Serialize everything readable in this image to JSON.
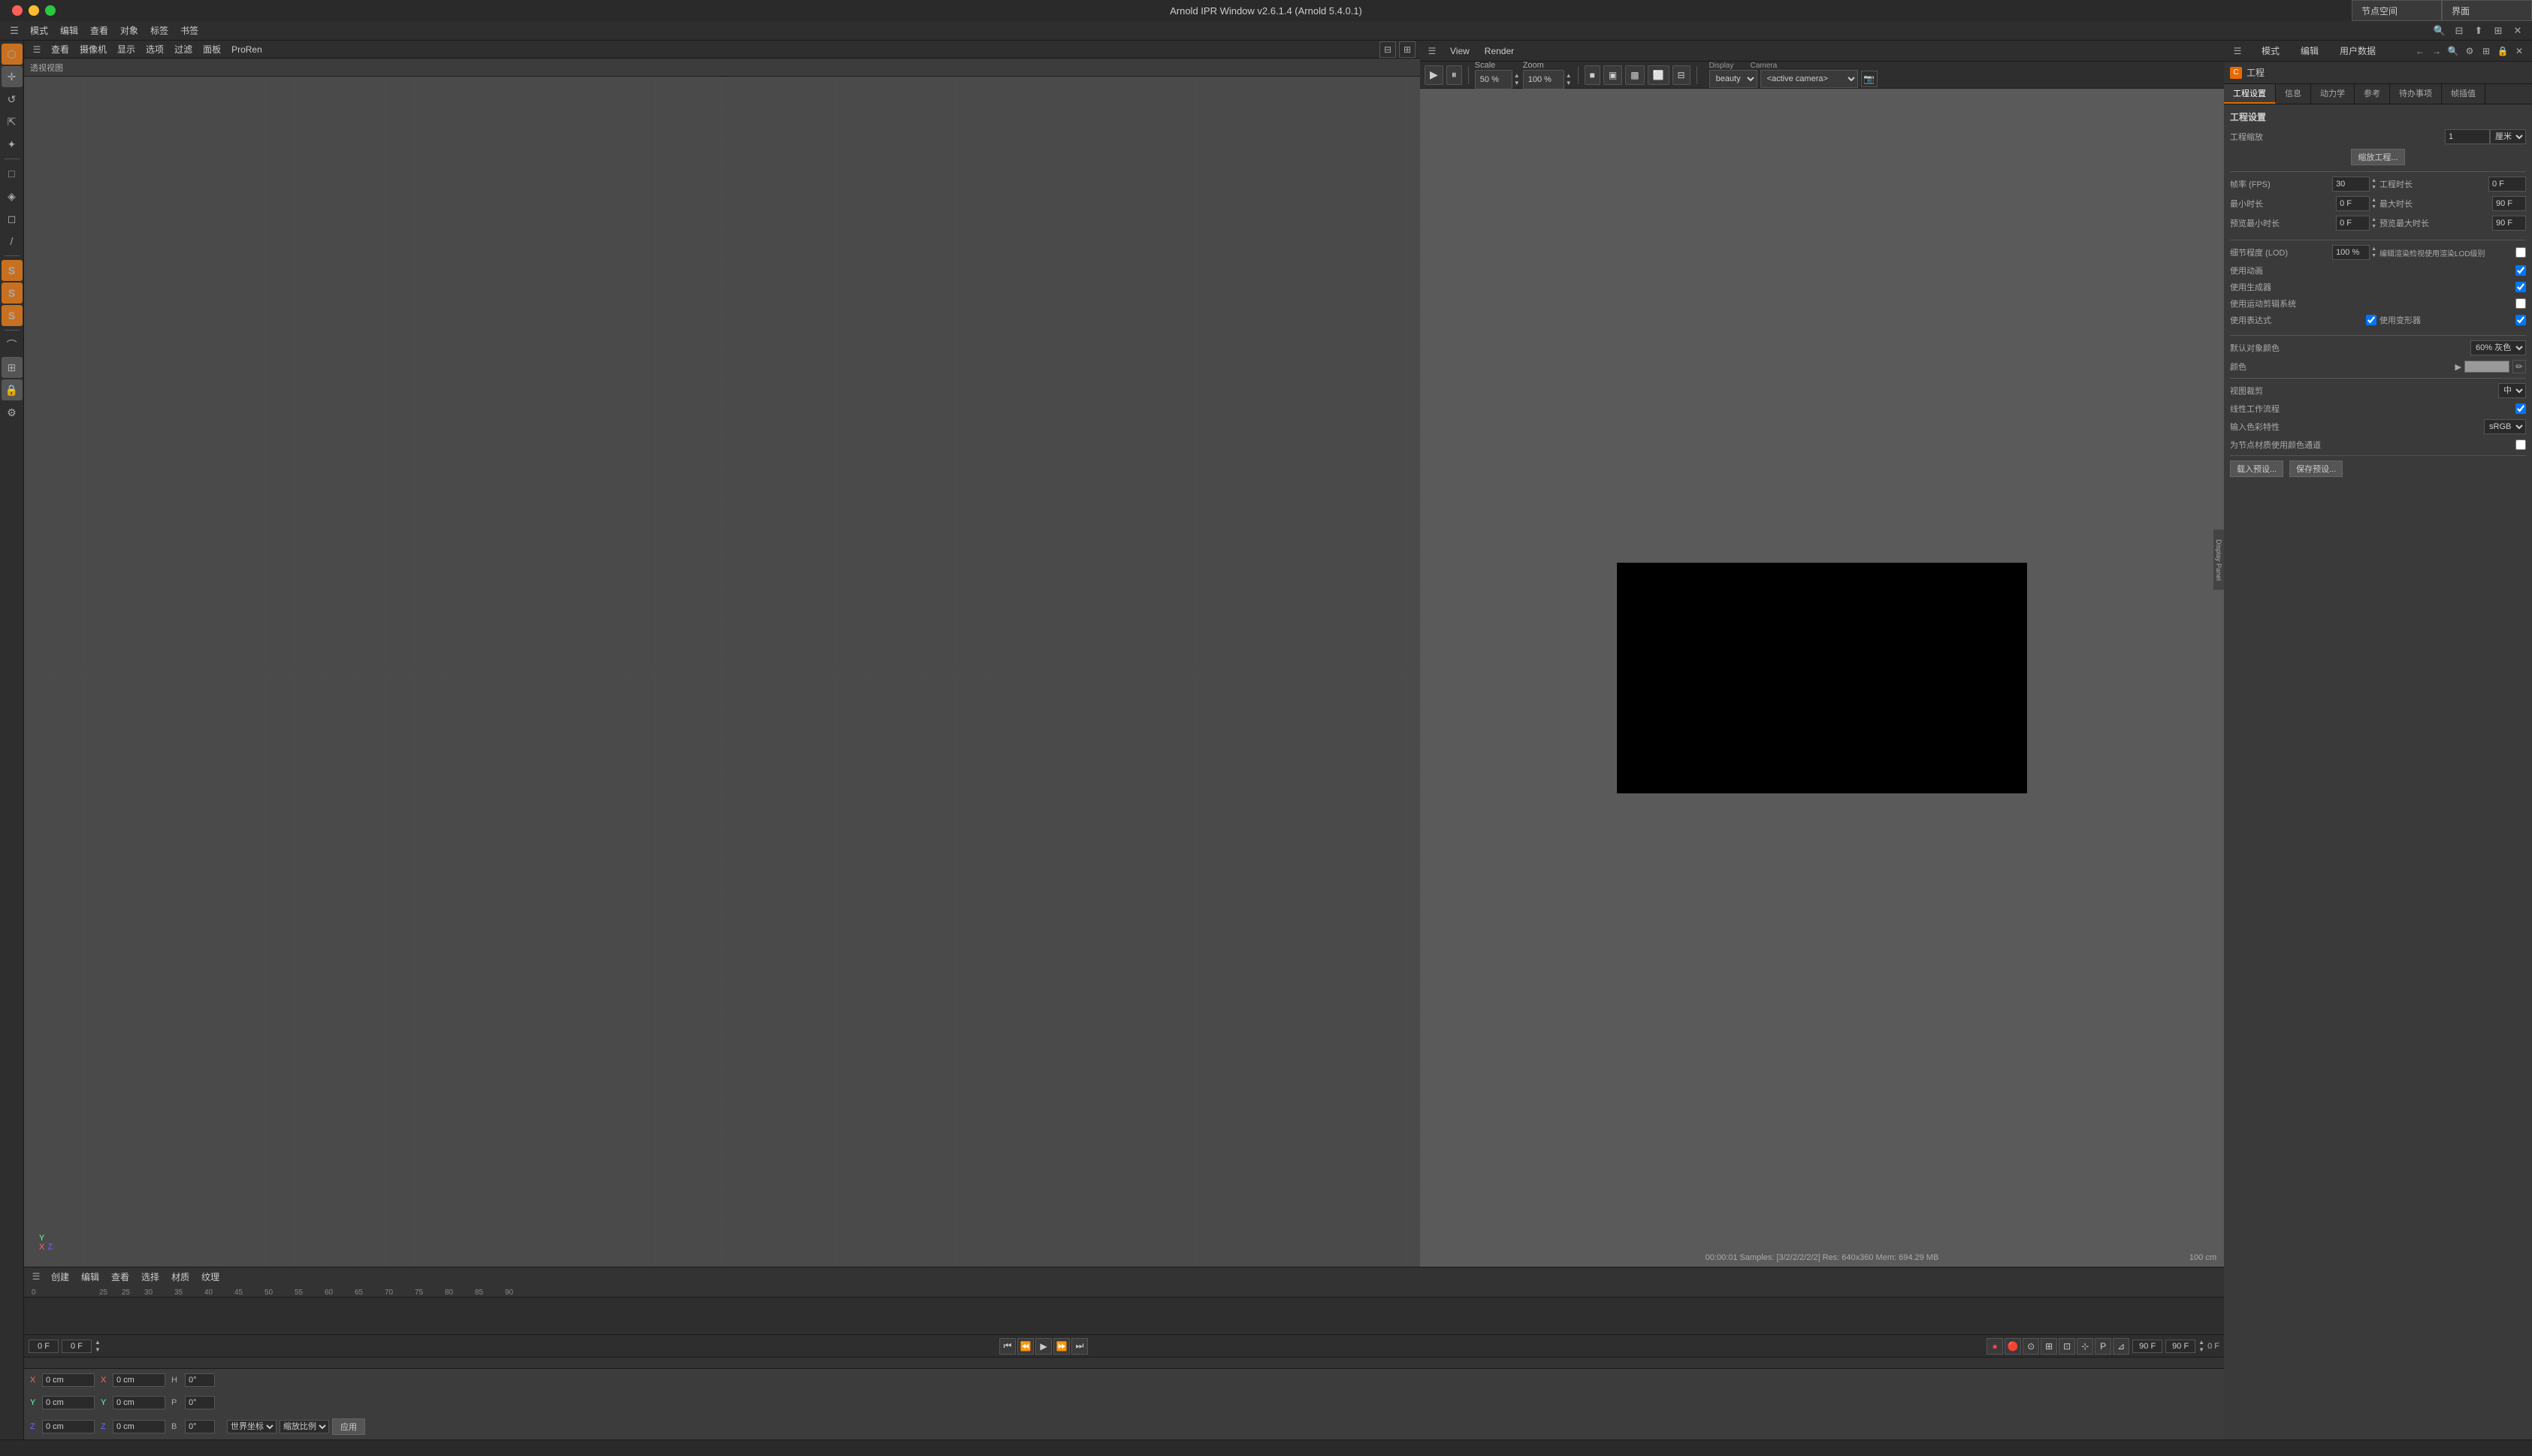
{
  "window": {
    "title": "Arnold IPR Window v2.6.1.4 (Arnold 5.4.0.1)",
    "traffic_lights": [
      "close",
      "minimize",
      "maximize"
    ]
  },
  "top_right": {
    "node_space_label": "节点空间",
    "interface_label": "界面"
  },
  "global_menu": {
    "items": [
      "模式",
      "编辑",
      "查看",
      "对象",
      "标签",
      "书签"
    ]
  },
  "ipr": {
    "toolbar": {
      "play_label": "▶",
      "pause_label": "⏸",
      "scale_label": "Scale",
      "scale_value": "50 %",
      "zoom_label": "Zoom",
      "zoom_value": "100 %",
      "display_label": "Display",
      "display_value": "beauty",
      "camera_label": "Camera",
      "camera_value": "<active camera>",
      "view_label": "View",
      "render_label": "Render"
    },
    "status": "00:00:01 Samples: [3/2/2/2/2/2] Res: 640x360 Mem: 694.29 MB",
    "scale_indicator": "100 cm",
    "side_panel": "Display\nPanel"
  },
  "viewport_3d": {
    "header": "透视视图",
    "menu_items": [
      "查看",
      "摄像机",
      "显示",
      "选项",
      "过滤",
      "面板",
      "ProRen"
    ]
  },
  "left_toolbar": {
    "icons": [
      {
        "name": "cube-icon",
        "symbol": "⬡"
      },
      {
        "name": "move-icon",
        "symbol": "+"
      },
      {
        "name": "rotate-icon",
        "symbol": "↻"
      },
      {
        "name": "scale-icon",
        "symbol": "⇱"
      },
      {
        "name": "transform-icon",
        "symbol": "✦"
      },
      {
        "name": "object-mode-icon",
        "symbol": "□"
      },
      {
        "name": "edit-mode-icon",
        "symbol": "◈"
      },
      {
        "name": "polygon-icon",
        "symbol": "◻"
      },
      {
        "name": "spline-icon",
        "symbol": "/"
      },
      {
        "name": "s-icon-1",
        "symbol": "S"
      },
      {
        "name": "s-icon-2",
        "symbol": "S"
      },
      {
        "name": "s-icon-3",
        "symbol": "S"
      },
      {
        "name": "bend-icon",
        "symbol": "⌒"
      },
      {
        "name": "grid-icon",
        "symbol": "⊞"
      },
      {
        "name": "lock-icon",
        "symbol": "🔒"
      },
      {
        "name": "settings-icon",
        "symbol": "⚙"
      }
    ]
  },
  "right_panel": {
    "top_menu": [
      "模式",
      "编辑",
      "用户数据"
    ],
    "project_header": {
      "icon": "C",
      "label": "工程"
    },
    "tabs": [
      "工程设置",
      "信息",
      "动力学",
      "参考",
      "待办事项",
      "帧插值"
    ],
    "active_tab": "工程设置",
    "section_title": "工程设置",
    "settings": {
      "scale_label": "工程缩放",
      "scale_value": "1",
      "scale_unit": "厘米",
      "collapse_btn": "缩放工程...",
      "fps_label": "帧率 (FPS)",
      "fps_value": "30",
      "duration_label": "工程时长",
      "duration_value": "0 F",
      "min_time_label": "最小时长",
      "min_time_value": "0 F",
      "max_time_label": "最大时长",
      "max_time_value": "90 F",
      "preview_min_label": "预览最小时长",
      "preview_min_value": "0 F",
      "preview_max_label": "预览最大时长",
      "preview_max_value": "90 F",
      "lod_label": "细节程度 (LOD)",
      "lod_value": "100 %",
      "lod_render_label": "编辑渲染检视使用渲染LOD级别",
      "use_animation_label": "使用动画",
      "use_generator_label": "使用生成器",
      "use_motion_blur_label": "使用运动剪辑系统",
      "use_expressions_label": "使用表达式",
      "use_deformers_label": "使用变形器",
      "default_object_color_label": "默认对象颜色",
      "default_object_color_value": "60% 灰色",
      "color_label": "颜色",
      "view_clip_label": "视图裁剪",
      "view_clip_value": "中",
      "linear_workflow_label": "线性工作流程",
      "color_input_label": "输入色彩特性",
      "color_input_value": "sRGB",
      "use_color_channel_label": "为节点材质使用颜色通道",
      "load_preset_label": "载入预设...",
      "save_preset_label": "保存预设..."
    }
  },
  "timeline": {
    "toolbar_menu": [
      "创建",
      "编辑",
      "查看",
      "选择",
      "材质",
      "纹理"
    ],
    "start_frame": "0 F",
    "end_frame": "90 F",
    "current_frame": "0 F",
    "preview_start": "90 F",
    "preview_end": "90 F",
    "frame_markers": [
      "0",
      "25",
      "25",
      "30",
      "35",
      "40",
      "45",
      "50",
      "55",
      "60",
      "65",
      "70",
      "75",
      "80",
      "85",
      "90"
    ],
    "transport_controls": [
      "⏮",
      "⏪",
      "▶",
      "⏩",
      "⏭"
    ],
    "record_btn": "●",
    "other_controls": [
      "🔴",
      "⊙",
      "⊞",
      "⊡",
      "⊹",
      "⊿"
    ]
  },
  "coords_panel": {
    "x_label": "X",
    "x_value": "0 cm",
    "y_label": "Y",
    "y_value": "0 cm",
    "z_label": "Z",
    "z_value": "0 cm",
    "x2_label": "X",
    "x2_value": "0 cm",
    "y2_label": "Y",
    "y2_value": "0 cm",
    "z2_label": "Z",
    "z2_value": "0 cm",
    "h_label": "H",
    "h_value": "0°",
    "p_label": "P",
    "p_value": "0°",
    "b_label": "B",
    "b_value": "0°",
    "world_coord_label": "世界坐标",
    "scale_ratio_label": "缩放比例",
    "apply_btn": "应用"
  },
  "status_bar": {
    "text": ""
  }
}
